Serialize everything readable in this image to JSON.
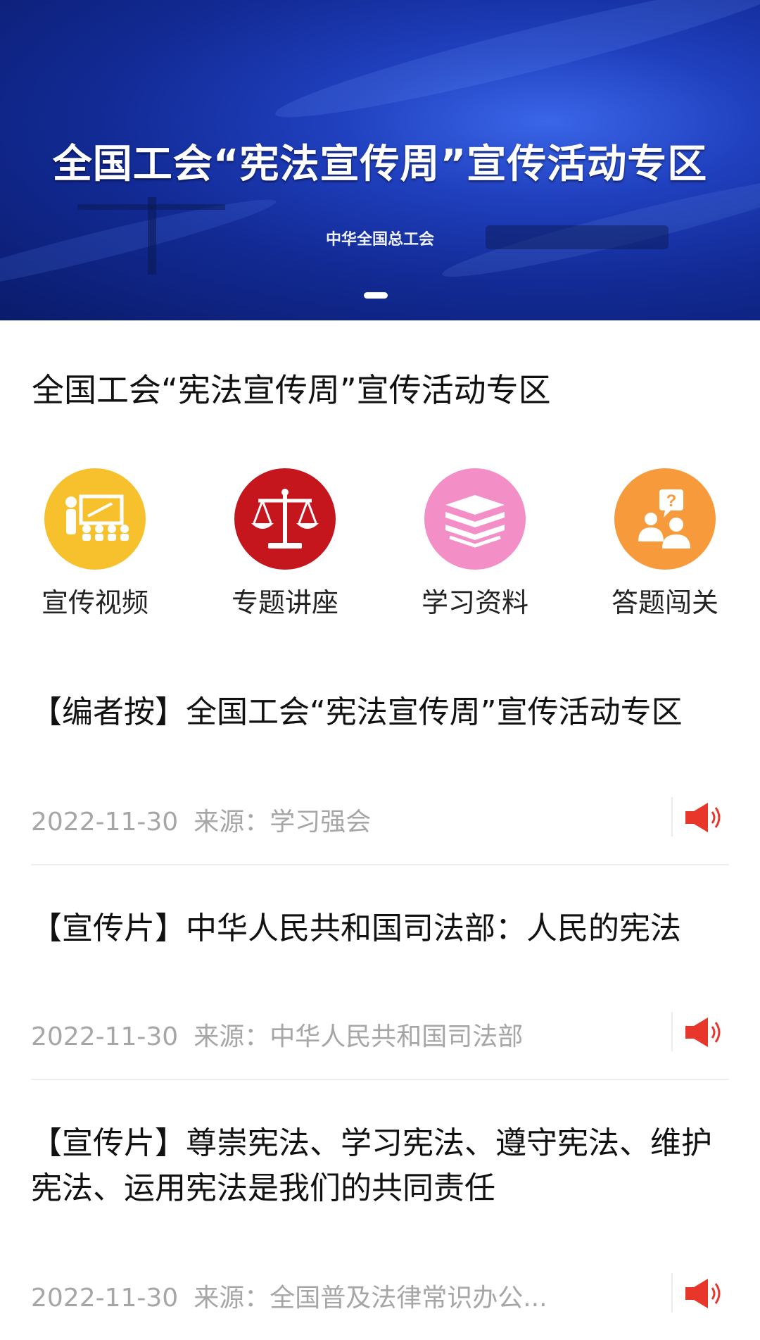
{
  "banner": {
    "title": "全国工会“宪法宣传周”宣传活动专区",
    "subtitle": "中华全国总工会"
  },
  "page_title": "全国工会“宪法宣传周”宣传活动专区",
  "categories": [
    {
      "label": "宣传视频",
      "icon": "teacher-board-icon",
      "color": "#f6c12d"
    },
    {
      "label": "专题讲座",
      "icon": "scales-icon",
      "color": "#c4161c"
    },
    {
      "label": "学习资料",
      "icon": "books-icon",
      "color": "#f48ec7"
    },
    {
      "label": "答题闯关",
      "icon": "question-people-icon",
      "color": "#f79a3c"
    }
  ],
  "articles": [
    {
      "title": "【编者按】全国工会“宪法宣传周”宣传活动专区",
      "date": "2022-11-30",
      "source": "来源：学习强会"
    },
    {
      "title": "【宣传片】中华人民共和国司法部：人民的宪法",
      "date": "2022-11-30",
      "source": "来源：中华人民共和国司法部"
    },
    {
      "title": "【宣传片】尊崇宪法、学习宪法、遵守宪法、维护宪法、运用宪法是我们的共同责任",
      "date": "2022-11-30",
      "source": "来源：全国普及法律常识办公..."
    }
  ],
  "colors": {
    "accent_red": "#e8362b",
    "meta_gray": "#a6a6a6"
  }
}
